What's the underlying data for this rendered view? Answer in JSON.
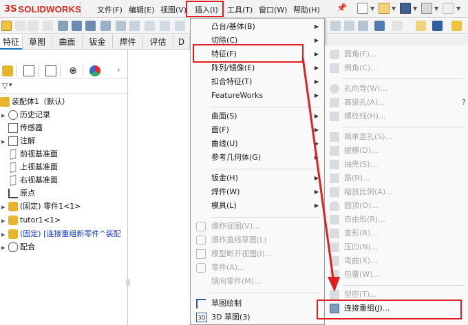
{
  "app": {
    "logo_symbol": "3S",
    "logo_text": "SOLIDWORKS"
  },
  "menubar": {
    "items": [
      "文件(F)",
      "编辑(E)",
      "视图(V)",
      "插入(I)",
      "工具(T)",
      "窗口(W)",
      "帮助(H)"
    ],
    "highlighted_index": 3
  },
  "tabs": [
    "特征",
    "草图",
    "曲面",
    "钣金",
    "焊件",
    "评估",
    "D"
  ],
  "filter_label": "▾",
  "tree": {
    "root": "装配体1（默认）",
    "items": [
      {
        "label": "历史记录",
        "icon": "history-icon"
      },
      {
        "label": "传感器",
        "icon": "sensor-icon"
      },
      {
        "label": "注解",
        "icon": "annotation-icon"
      },
      {
        "label": "前视基准面",
        "icon": "plane-icon"
      },
      {
        "label": "上视基准面",
        "icon": "plane-icon"
      },
      {
        "label": "右视基准面",
        "icon": "plane-icon"
      },
      {
        "label": "原点",
        "icon": "origin-icon"
      },
      {
        "label": "(固定) 零件1<1>",
        "icon": "part-icon"
      },
      {
        "label": "tutor1<1>",
        "icon": "part-icon"
      },
      {
        "label": "(固定) [连接重组新零件^装配",
        "icon": "part-icon"
      },
      {
        "label": "配合",
        "icon": "mate-icon"
      }
    ]
  },
  "insert_menu": {
    "items": [
      {
        "label": "凸台/基体(B)",
        "submenu": true,
        "disabled": false
      },
      {
        "label": "切除(C)",
        "submenu": true,
        "disabled": false
      },
      {
        "label": "特征(F)",
        "submenu": true,
        "disabled": false
      },
      {
        "label": "阵列/镜像(E)",
        "submenu": true,
        "disabled": false
      },
      {
        "label": "扣合特征(T)",
        "submenu": true,
        "disabled": false
      },
      {
        "label": "FeatureWorks",
        "submenu": true,
        "disabled": false
      },
      {
        "label": "曲面(S)",
        "submenu": true,
        "disabled": false
      },
      {
        "label": "面(F)",
        "submenu": true,
        "disabled": false
      },
      {
        "label": "曲线(U)",
        "submenu": true,
        "disabled": false
      },
      {
        "label": "参考几何体(G)",
        "submenu": true,
        "disabled": false
      },
      {
        "label": "钣金(H)",
        "submenu": true,
        "disabled": false
      },
      {
        "label": "焊件(W)",
        "submenu": true,
        "disabled": false
      },
      {
        "label": "模具(L)",
        "submenu": true,
        "disabled": false
      },
      {
        "label": "爆炸视图(V)...",
        "submenu": false,
        "disabled": true
      },
      {
        "label": "爆炸直线草图(L)",
        "submenu": false,
        "disabled": true
      },
      {
        "label": "模型断开视图(I)...",
        "submenu": false,
        "disabled": true
      },
      {
        "label": "零件(A)...",
        "submenu": false,
        "disabled": true
      },
      {
        "label": "镜向零件(M)...",
        "submenu": false,
        "disabled": true
      },
      {
        "label": "草图绘制",
        "submenu": false,
        "disabled": false
      },
      {
        "label": "3D 草图(3)",
        "submenu": false,
        "disabled": false
      }
    ],
    "highlighted_index": 2
  },
  "feature_submenu": {
    "items": [
      {
        "label": "圆角(F)...",
        "enabled": false
      },
      {
        "label": "倒角(C)...",
        "enabled": false
      },
      {
        "label": "孔向导(W)...",
        "enabled": false
      },
      {
        "label": "高级孔(A)...",
        "enabled": false
      },
      {
        "label": "螺纹线(H)...",
        "enabled": false
      },
      {
        "label": "简单直孔(S)...",
        "enabled": false
      },
      {
        "label": "拔模(D)...",
        "enabled": false
      },
      {
        "label": "抽壳(S)...",
        "enabled": false
      },
      {
        "label": "筋(R)...",
        "enabled": false
      },
      {
        "label": "缩放比例(A)...",
        "enabled": false
      },
      {
        "label": "圆顶(O)...",
        "enabled": false
      },
      {
        "label": "自由形(R)...",
        "enabled": false
      },
      {
        "label": "变形(R)...",
        "enabled": false
      },
      {
        "label": "压凹(N)...",
        "enabled": false
      },
      {
        "label": "弯曲(X)...",
        "enabled": false
      },
      {
        "label": "包覆(W)...",
        "enabled": false
      },
      {
        "label": "型腔(T)...",
        "enabled": false
      },
      {
        "label": "连接重组(J)...",
        "enabled": true
      }
    ],
    "highlighted_index": 17
  },
  "colors": {
    "highlight": "#e02020",
    "brand": "#d52b1e",
    "tab_accent": "#1c6fbf"
  }
}
